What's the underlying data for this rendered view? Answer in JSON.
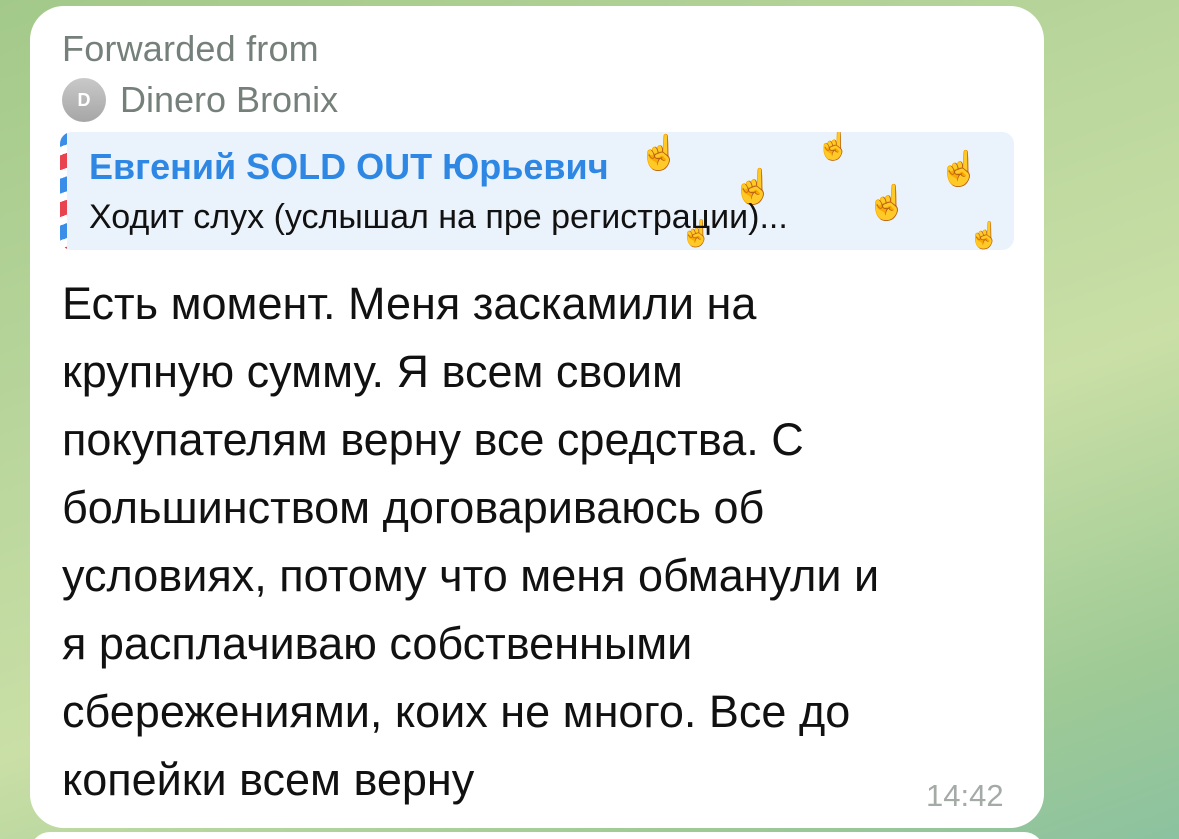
{
  "forward": {
    "label": "Forwarded from",
    "avatar_initial": "D",
    "source_name": "Dinero Bronix"
  },
  "reply": {
    "author": "Евгений SOLD OUT Юрьевич",
    "text": "Ходит слух (услышал на пре регистрации)..."
  },
  "message": {
    "lines": [
      "Есть момент. Меня заскамили на",
      "крупную сумму. Я всем своим",
      "покупателям верну все средства. С",
      "большинством договариваюсь об",
      "условиях, потому что меня обманули и",
      "я расплачиваю собственными",
      "сбережениями, коих не много. Все до",
      "копейки всем верну"
    ],
    "time": "14:42"
  },
  "colors": {
    "reply_author": "#2f87e4",
    "reply_background": "#eaf2fb",
    "secondary_text": "#76807a",
    "timestamp": "#a4aaa6"
  },
  "icons": {
    "reply_pattern": "hand-gesture-icon"
  }
}
